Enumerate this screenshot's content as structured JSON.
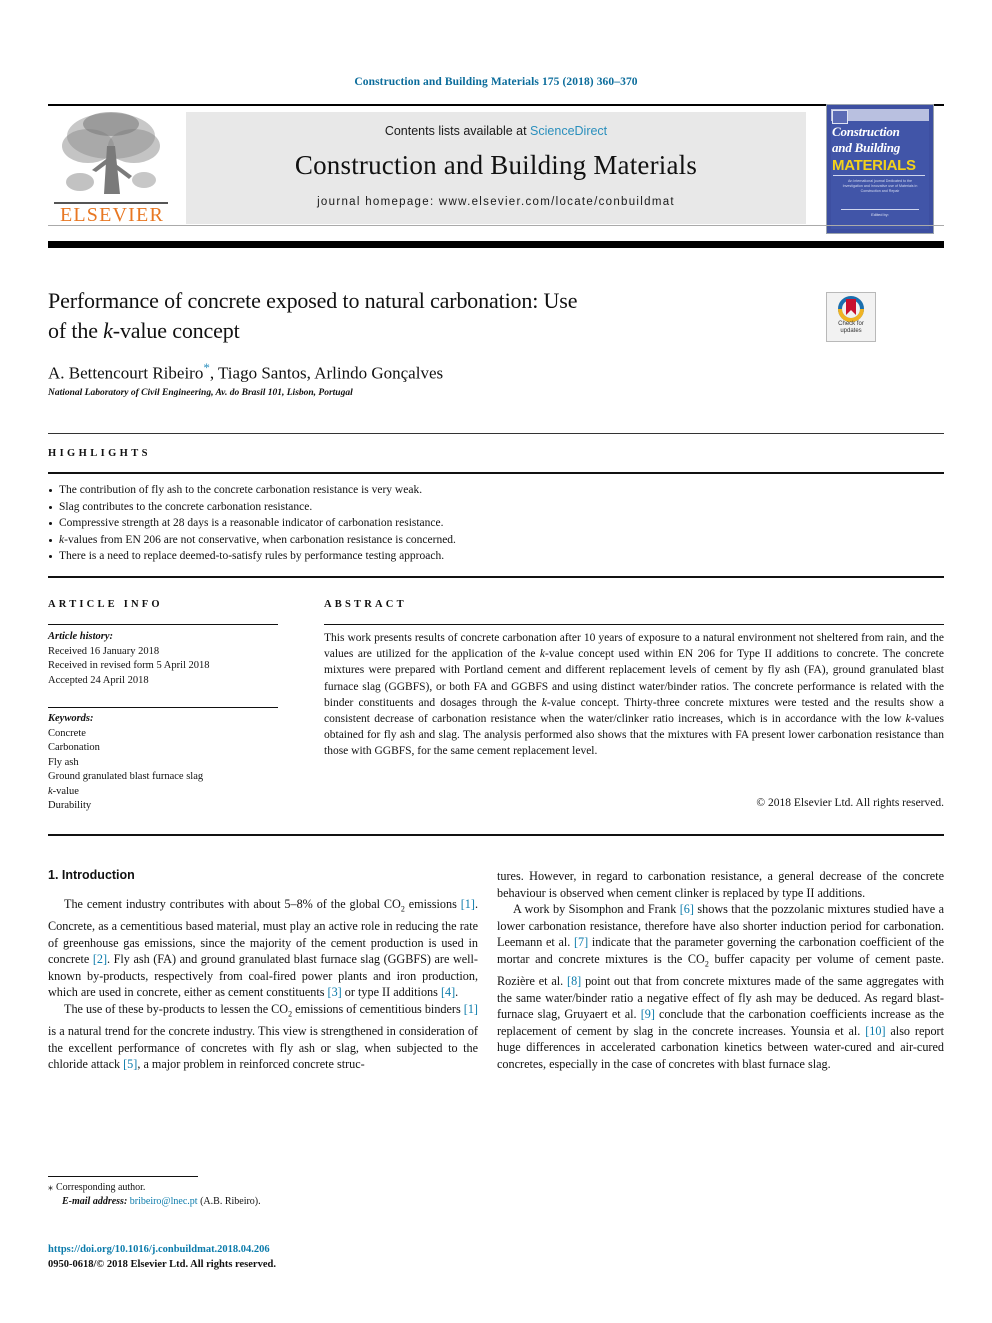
{
  "running_head": "Construction and Building Materials 175 (2018) 360–370",
  "masthead": {
    "contents_prefix": "Contents lists available at ",
    "sciencedirect": "ScienceDirect",
    "journal_title": "Construction and Building Materials",
    "homepage": "journal homepage: www.elsevier.com/locate/conbuildmat",
    "publisher_wordmark": "ELSEVIER",
    "cover": {
      "line1": "Construction",
      "line2": "and Building",
      "line3": "MATERIALS",
      "blurb": "An international journal Dedicated to the Investigation and Innovative use of Materials in Construction and Repair",
      "footer": "Edited by:"
    }
  },
  "article": {
    "title_line1": "Performance of concrete exposed to natural carbonation: Use",
    "title_line2_pre": "of the ",
    "title_line2_italic": "k",
    "title_line2_post": "-value concept",
    "authors_pre": "A. Bettencourt Ribeiro",
    "authors_star": "*",
    "authors_post": ", Tiago Santos, Arlindo Gonçalves",
    "affiliation": "National Laboratory of Civil Engineering, Av. do Brasil 101, Lisbon, Portugal",
    "crossmark_label_l1": "Check for",
    "crossmark_label_l2": "updates"
  },
  "highlights": {
    "heading": "HIGHLIGHTS",
    "items": [
      "The contribution of fly ash to the concrete carbonation resistance is very weak.",
      "Slag contributes to the concrete carbonation resistance.",
      "Compressive strength at 28 days is a reasonable indicator of carbonation resistance.",
      "k-values from EN 206 are not conservative, when carbonation resistance is concerned.",
      "There is a need to replace deemed-to-satisfy rules by performance testing approach."
    ]
  },
  "article_info": {
    "heading": "ARTICLE INFO",
    "history_label": "Article history:",
    "history": [
      "Received 16 January 2018",
      "Received in revised form 5 April 2018",
      "Accepted 24 April 2018"
    ],
    "keywords_label": "Keywords:",
    "keywords": [
      "Concrete",
      "Carbonation",
      "Fly ash",
      "Ground granulated blast furnace slag",
      "k-value",
      "Durability"
    ]
  },
  "abstract": {
    "heading": "ABSTRACT",
    "text": "This work presents results of concrete carbonation after 10 years of exposure to a natural environment not sheltered from rain, and the values are utilized for the application of the k-value concept used within EN 206 for Type II additions to concrete. The concrete mixtures were prepared with Portland cement and different replacement levels of cement by fly ash (FA), ground granulated blast furnace slag (GGBFS), or both FA and GGBFS and using distinct water/binder ratios. The concrete performance is related with the binder constituents and dosages through the k-value concept. Thirty-three concrete mixtures were tested and the results show a consistent decrease of carbonation resistance when the water/clinker ratio increases, which is in accordance with the low k-values obtained for fly ash and slag. The analysis performed also shows that the mixtures with FA present lower carbonation resistance than those with GGBFS, for the same cement replacement level.",
    "copyright": "© 2018 Elsevier Ltd. All rights reserved."
  },
  "body": {
    "section_title": "1. Introduction",
    "left_paragraph_1": "The cement industry contributes with about 5–8% of the global CO2 emissions [1]. Concrete, as a cementitious based material, must play an active role in reducing the rate of greenhouse gas emissions, since the majority of the cement production is used in concrete [2]. Fly ash (FA) and ground granulated blast furnace slag (GGBFS) are well-known by-products, respectively from coal-fired power plants and iron production, which are used in concrete, either as cement constituents [3] or type II additions [4].",
    "left_paragraph_2": "The use of these by-products to lessen the CO2 emissions of cementitious binders [1] is a natural trend for the concrete industry. This view is strengthened in consideration of the excellent performance of concretes with fly ash or slag, when subjected to the chloride attack [5], a major problem in reinforced concrete struc-",
    "right_paragraph_1": "tures. However, in regard to carbonation resistance, a general decrease of the concrete behaviour is observed when cement clinker is replaced by type II additions.",
    "right_paragraph_2": "A work by Sisomphon and Frank [6] shows that the pozzolanic mixtures studied have a lower carbonation resistance, therefore have also shorter induction period for carbonation. Leemann et al. [7] indicate that the parameter governing the carbonation coefficient of the mortar and concrete mixtures is the CO2 buffer capacity per volume of cement paste. Rozière et al. [8] point out that from concrete mixtures made of the same aggregates with the same water/binder ratio a negative effect of fly ash may be deduced. As regard blast-furnace slag, Gruyaert et al. [9] conclude that the carbonation coefficients increase as the replacement of cement by slag in the concrete increases. Younsia et al. [10] also report huge differences in accelerated carbonation kinetics between water-cured and air-cured concretes, especially in the case of concretes with blast furnace slag."
  },
  "footer": {
    "corresponding_star": "⁎",
    "corresponding_label": "Corresponding author.",
    "email_label": "E-mail address:",
    "email": "bribeiro@lnec.pt",
    "email_suffix": "(A.B. Ribeiro).",
    "doi": "https://doi.org/10.1016/j.conbuildmat.2018.04.206",
    "issn": "0950-0618/© 2018 Elsevier Ltd. All rights reserved."
  },
  "colors": {
    "link": "#0b7bab",
    "running_head": "#0b6c9b",
    "elsevier_orange": "#e87722",
    "sciencedirect": "#2a8fbd"
  }
}
